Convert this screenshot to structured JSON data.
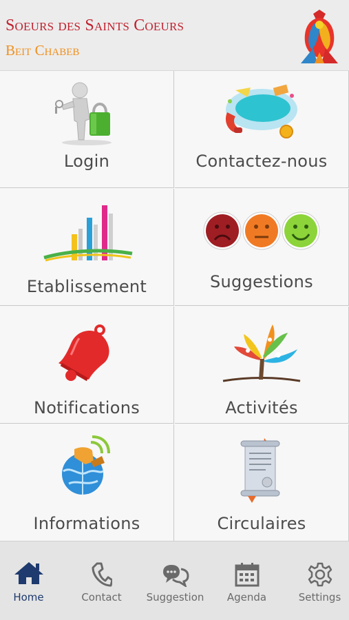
{
  "header": {
    "title": "Soeurs des Saints Coeurs",
    "subtitle": "Beit Chabeb",
    "title_color": "#c0202e",
    "subtitle_color": "#f0901f"
  },
  "menu": [
    {
      "label": "Login",
      "icon": "login-key-lock-icon"
    },
    {
      "label": "Contactez-nous",
      "icon": "contact-phone-bubble-icon"
    },
    {
      "label": "Etablissement",
      "icon": "establishment-bars-icon"
    },
    {
      "label": "Suggestions",
      "icon": "smiley-faces-icon"
    },
    {
      "label": "Notifications",
      "icon": "bell-icon"
    },
    {
      "label": "Activités",
      "icon": "activity-tree-icon"
    },
    {
      "label": "Informations",
      "icon": "globe-info-icon"
    },
    {
      "label": "Circulaires",
      "icon": "scroll-certificate-icon"
    }
  ],
  "tabs": [
    {
      "label": "Home",
      "icon": "home-icon",
      "active": true
    },
    {
      "label": "Contact",
      "icon": "phone-icon",
      "active": false
    },
    {
      "label": "Suggestion",
      "icon": "chat-bubbles-icon",
      "active": false
    },
    {
      "label": "Agenda",
      "icon": "calendar-icon",
      "active": false
    },
    {
      "label": "Settings",
      "icon": "gear-icon",
      "active": false
    }
  ],
  "colors": {
    "active_tab": "#1e3a6e",
    "inactive_tab": "#6a6a6a",
    "tab_bar_bg": "#e4e4e4"
  }
}
